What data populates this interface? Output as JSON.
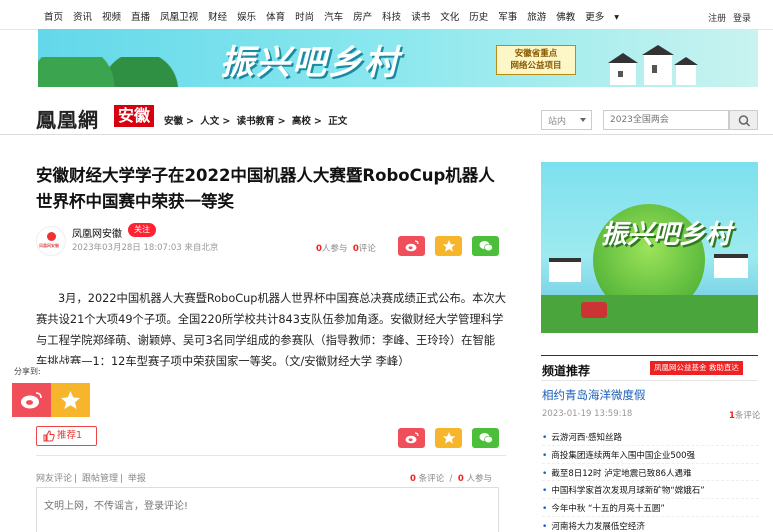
{
  "nav": {
    "items": [
      "首页",
      "资讯",
      "视频",
      "直播",
      "凤凰卫视",
      "财经",
      "娱乐",
      "体育",
      "时尚",
      "汽车",
      "房产",
      "科技",
      "读书",
      "文化",
      "历史",
      "军事",
      "旅游",
      "佛教"
    ],
    "more": "更多",
    "register": "注册",
    "login": "登录"
  },
  "banner": {
    "title": "振兴吧乡村",
    "badge_line1": "安徽省重点",
    "badge_line2": "网络公益项目"
  },
  "logo": {
    "brand": "鳳凰網",
    "region": "安徽"
  },
  "breadcrumb": [
    "安徽",
    "人文",
    "读书教育",
    "高校",
    "正文"
  ],
  "search": {
    "scope": "站内",
    "placeholder": "2023全国两会"
  },
  "article": {
    "title": "安徽财经大学学子在2022中国机器人大赛暨RoboCup机器人世界杯中国赛中荣获一等奖",
    "author": "凤凰网安徽",
    "avatar_text": "凤凰网安徽",
    "follow": "关注",
    "meta": "2023年03月28日 18:07:03 来自北京",
    "participants": "0",
    "participants_label": "人参与",
    "comments": "0",
    "comments_label": "评论",
    "body": "3月，2022中国机器人大赛暨RoboCup机器人世界杯中国赛总决赛成绩正式公布。本次大赛共设21个大项49个子项。全国220所学校共计843支队伍参加角逐。安徽财经大学管理科学与工程学院郑绎萌、谢颖婷、吴可3名同学组成的参赛队（指导教师：李峰、王玲玲）在智能车挑战赛—1：12车型赛子项中荣获国家一等奖。（文/安徽财经大学 李峰）",
    "share_label": "分享到:",
    "recommend": "推荐1"
  },
  "comments_area": {
    "links": [
      "网友评论",
      "跟帖管理",
      "举报"
    ],
    "comment_count": "0",
    "comment_label": "条评论",
    "participants_count": "0",
    "participants_label": "人参与",
    "placeholder": "文明上网，不传谣言，登录评论!"
  },
  "sidebar": {
    "banner_title": "振兴吧乡村",
    "feed_title": "频道推荐",
    "feed_tag": "凤凰网公益基金 救助直达",
    "headline": "相约青岛海洋微度假",
    "headline_date": "2023-01-19 13:59:18",
    "headline_count": "1",
    "headline_count_label": "条评论",
    "items": [
      "云游河西·感知丝路",
      "商投集团连续两年入围中国企业500强",
      "截至8日12时 泸定地震已致86人遇难",
      "中国科学家首次发现月球新矿物“嫦娥石”",
      "今年中秋 “十五的月亮十五圆”",
      "河南将大力发展低空经济"
    ]
  },
  "colors": {
    "brand_red": "#d6000f",
    "link_blue": "#1a5eb8",
    "weibo": "#f04f5a",
    "favorite": "#f6b52a",
    "wechat": "#4bbf3a"
  }
}
